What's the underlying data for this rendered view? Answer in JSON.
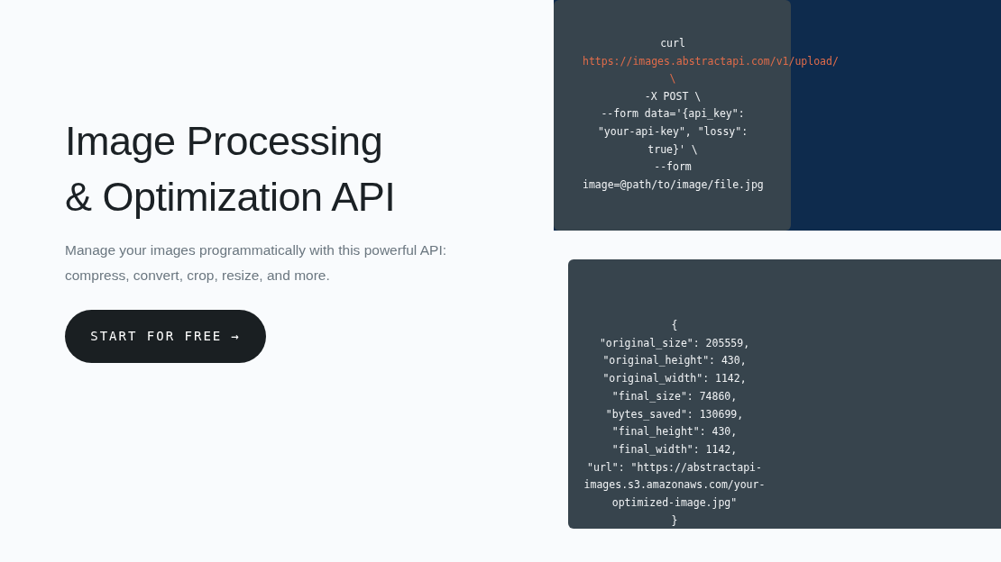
{
  "hero": {
    "title_lines": [
      "Image Processing",
      "& Optimization API"
    ],
    "description": "Manage your images programmatically with this powerful API: compress, convert, crop, resize, and more.",
    "button": {
      "label": "START FOR FREE",
      "arrow": "→"
    }
  },
  "request_code": [
    {
      "kind": "plain",
      "text": "curl"
    },
    {
      "kind": "url",
      "text": "https://images.abstractapi.com/v1/upload/"
    },
    {
      "kind": "url",
      "text": "\\"
    },
    {
      "kind": "plain",
      "text": "-X POST \\"
    },
    {
      "kind": "plain",
      "text": "--form data='{api_key\":"
    },
    {
      "kind": "plain",
      "text": "\"your-api-key\", \"lossy\":"
    },
    {
      "kind": "plain",
      "text": "true}' \\"
    },
    {
      "kind": "plain",
      "text": "--form"
    },
    {
      "kind": "plain",
      "text": "image=@path/to/image/file.jpg"
    }
  ],
  "response_code": [
    {
      "kind": "plain",
      "text": "{"
    },
    {
      "kind": "plain",
      "text": "\"original_size\": 205559,"
    },
    {
      "kind": "plain",
      "text": "\"original_height\": 430,"
    },
    {
      "kind": "plain",
      "text": "\"original_width\": 1142,"
    },
    {
      "kind": "plain",
      "text": "\"final_size\": 74860,"
    },
    {
      "kind": "plain",
      "text": "\"bytes_saved\": 130699,"
    },
    {
      "kind": "plain",
      "text": "\"final_height\": 430,"
    },
    {
      "kind": "plain",
      "text": "\"final_width\": 1142,"
    },
    {
      "kind": "plain",
      "text": "\"url\": \"https://abstractapi-"
    },
    {
      "kind": "plain",
      "text": "images.s3.amazonaws.com/your-"
    },
    {
      "kind": "plain",
      "text": "optimized-image.jpg\""
    },
    {
      "kind": "plain",
      "text": "}"
    }
  ]
}
